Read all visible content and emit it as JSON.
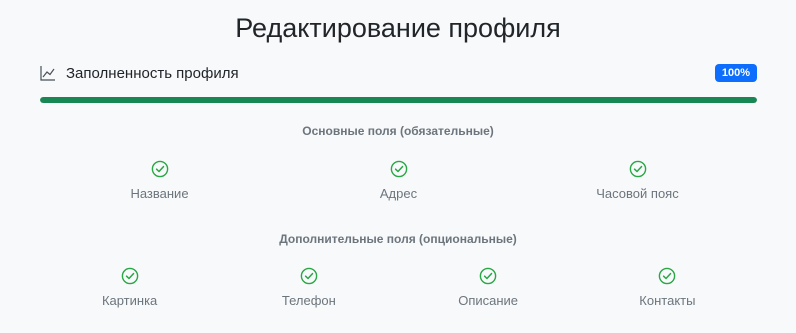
{
  "page": {
    "title": "Редактирование профиля"
  },
  "completeness": {
    "icon": "line-chart-icon",
    "label": "Заполненность профиля",
    "badge": "100%",
    "progress": 1.0,
    "accent_color": "#198754",
    "badge_color": "#0d6efd"
  },
  "required_section": {
    "heading": "Основные поля (обязательные)",
    "fields": [
      {
        "label": "Название",
        "icon": "check-circle-icon",
        "done": true
      },
      {
        "label": "Адрес",
        "icon": "check-circle-icon",
        "done": true
      },
      {
        "label": "Часовой пояс",
        "icon": "check-circle-icon",
        "done": true
      }
    ]
  },
  "optional_section": {
    "heading": "Дополнительные поля (опциональные)",
    "fields": [
      {
        "label": "Картинка",
        "icon": "check-circle-icon",
        "done": true
      },
      {
        "label": "Телефон",
        "icon": "check-circle-icon",
        "done": true
      },
      {
        "label": "Описание",
        "icon": "check-circle-icon",
        "done": true
      },
      {
        "label": "Контакты",
        "icon": "check-circle-icon",
        "done": true
      }
    ]
  }
}
